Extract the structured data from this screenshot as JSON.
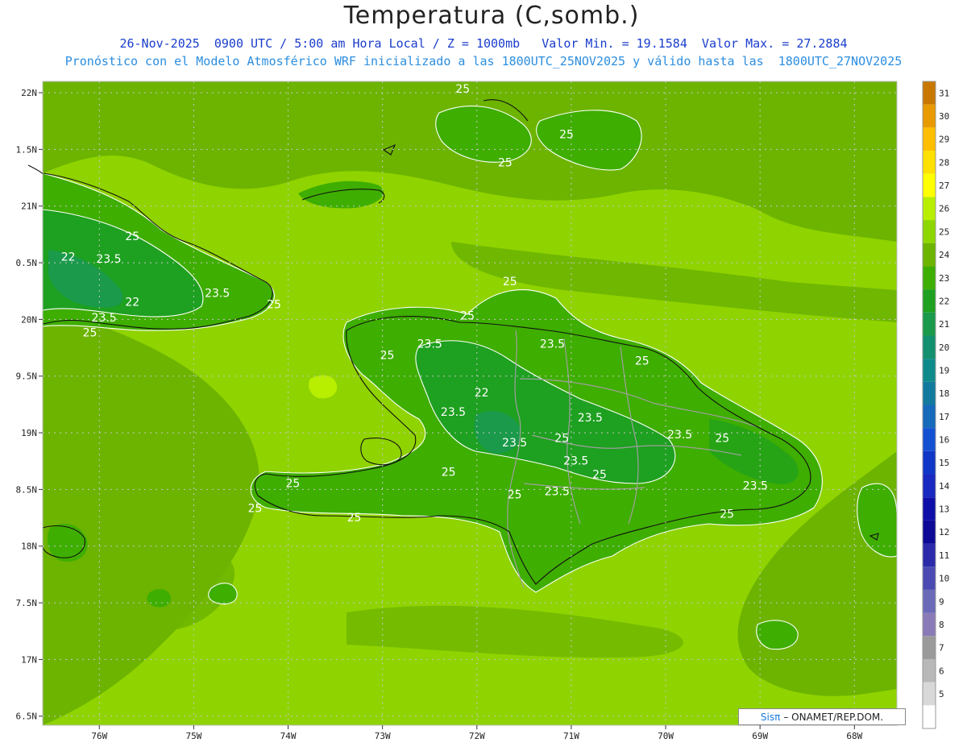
{
  "title": "Temperatura (C,somb.)",
  "subtitle_line1": "26-Nov-2025  0900 UTC / 5:00 am Hora Local / Z = 1000mb   Valor Min. = 19.1584  Valor Max. = 27.2884",
  "subtitle_line2": "Pronóstico con el Modelo Atmosférico WRF inicializado a las 1800UTC_25NOV2025 y válido hasta las  1800UTC_27NOV2025",
  "credit": {
    "brand": "Sisπ",
    "text": "– ONAMET/REP.DOM."
  },
  "lat_ticks": [
    "22N",
    "1.5N",
    "21N",
    "0.5N",
    "20N",
    "9.5N",
    "19N",
    "8.5N",
    "18N",
    "7.5N",
    "17N",
    "6.5N"
  ],
  "lon_ticks": [
    "76W",
    "75W",
    "74W",
    "73W",
    "72W",
    "71W",
    "70W",
    "69W",
    "68W"
  ],
  "colorbar": {
    "levels": [
      31,
      30,
      29,
      28,
      27,
      26,
      25,
      24,
      23,
      22,
      21,
      20,
      19,
      18,
      17,
      16,
      15,
      14,
      13,
      12,
      11,
      10,
      9,
      8,
      7,
      6,
      5
    ],
    "colors": [
      "#c87800",
      "#e89a00",
      "#ffbe00",
      "#ffe100",
      "#ffff00",
      "#b8ee00",
      "#8ed600",
      "#6cb400",
      "#3eae00",
      "#1ea020",
      "#1a9a4a",
      "#13906e",
      "#0f8a8a",
      "#127a9e",
      "#166aba",
      "#1450d2",
      "#1036c8",
      "#1828c0",
      "#0e0ea8",
      "#0c0a96",
      "#2a2aaa",
      "#4a4ab2",
      "#6a6ab8",
      "#8a7ab8",
      "#9a9a9a",
      "#b8b8b8",
      "#d8d8d8",
      "#ffffff"
    ]
  },
  "contour_labels": [
    {
      "text": "25",
      "lon": -72.15,
      "lat": 22.0
    },
    {
      "text": "25",
      "lon": -71.05,
      "lat": 21.6
    },
    {
      "text": "25",
      "lon": -71.7,
      "lat": 21.35
    },
    {
      "text": "25",
      "lon": -75.65,
      "lat": 20.7
    },
    {
      "text": "22",
      "lon": -76.33,
      "lat": 20.52
    },
    {
      "text": "23.5",
      "lon": -75.9,
      "lat": 20.5
    },
    {
      "text": "23.5",
      "lon": -74.75,
      "lat": 20.2
    },
    {
      "text": "25",
      "lon": -74.15,
      "lat": 20.1
    },
    {
      "text": "22",
      "lon": -75.65,
      "lat": 20.12
    },
    {
      "text": "23.5",
      "lon": -75.95,
      "lat": 19.98
    },
    {
      "text": "25",
      "lon": -76.1,
      "lat": 19.85
    },
    {
      "text": "25",
      "lon": -71.65,
      "lat": 20.3
    },
    {
      "text": "25",
      "lon": -72.1,
      "lat": 20.0
    },
    {
      "text": "23.5",
      "lon": -72.5,
      "lat": 19.75
    },
    {
      "text": "25",
      "lon": -72.95,
      "lat": 19.65
    },
    {
      "text": "23.5",
      "lon": -71.2,
      "lat": 19.75
    },
    {
      "text": "25",
      "lon": -70.25,
      "lat": 19.6
    },
    {
      "text": "22",
      "lon": -71.95,
      "lat": 19.32
    },
    {
      "text": "23.5",
      "lon": -72.25,
      "lat": 19.15
    },
    {
      "text": "23.5",
      "lon": -70.8,
      "lat": 19.1
    },
    {
      "text": "23.5",
      "lon": -69.85,
      "lat": 18.95
    },
    {
      "text": "23.5",
      "lon": -71.6,
      "lat": 18.88
    },
    {
      "text": "25",
      "lon": -71.1,
      "lat": 18.92
    },
    {
      "text": "25",
      "lon": -69.4,
      "lat": 18.92
    },
    {
      "text": "23.5",
      "lon": -70.95,
      "lat": 18.72
    },
    {
      "text": "25",
      "lon": -72.3,
      "lat": 18.62
    },
    {
      "text": "25",
      "lon": -70.7,
      "lat": 18.6
    },
    {
      "text": "25",
      "lon": -73.95,
      "lat": 18.52
    },
    {
      "text": "23.5",
      "lon": -69.05,
      "lat": 18.5
    },
    {
      "text": "25",
      "lon": -71.6,
      "lat": 18.42
    },
    {
      "text": "23.5",
      "lon": -71.15,
      "lat": 18.45
    },
    {
      "text": "25",
      "lon": -74.35,
      "lat": 18.3
    },
    {
      "text": "25",
      "lon": -73.3,
      "lat": 18.22
    },
    {
      "text": "25",
      "lon": -69.35,
      "lat": 18.25
    }
  ]
}
